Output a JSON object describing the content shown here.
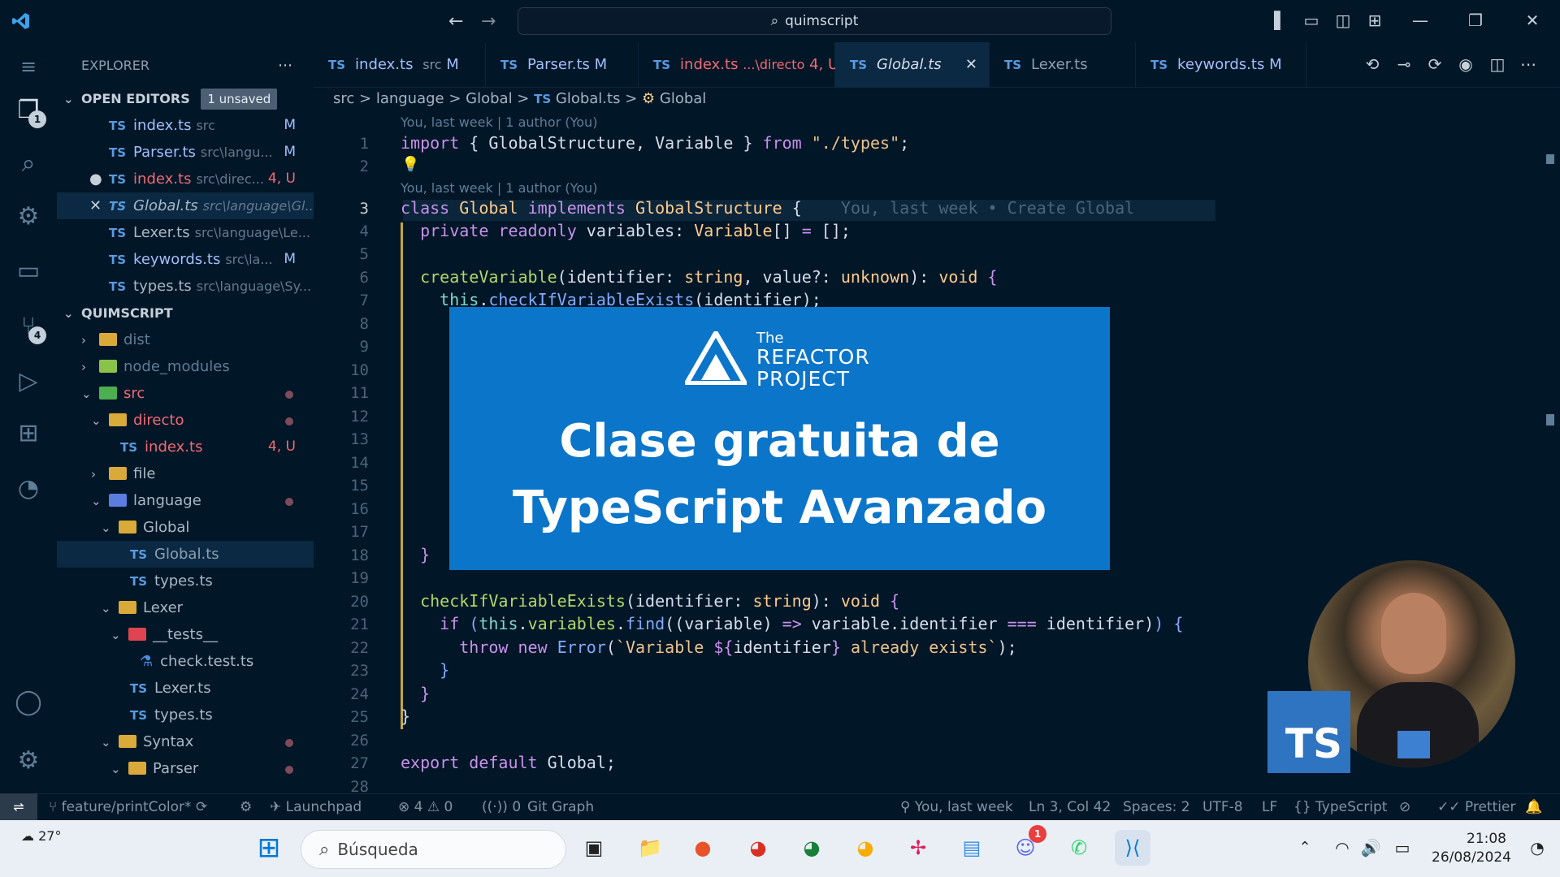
{
  "window": {
    "search_text": "quimscript"
  },
  "sidebar": {
    "title": "EXPLORER",
    "open_editors": {
      "label": "OPEN EDITORS",
      "unsaved_badge": "1 unsaved",
      "items": [
        {
          "name": "index.ts",
          "path": "src",
          "status": "M"
        },
        {
          "name": "Parser.ts",
          "path": "src\\langu...",
          "status": "M"
        },
        {
          "name": "index.ts",
          "path": "src\\direc...",
          "status": "4, U"
        },
        {
          "name": "Global.ts",
          "path": "src\\language\\Gl..."
        },
        {
          "name": "Lexer.ts",
          "path": "src\\language\\Le..."
        },
        {
          "name": "keywords.ts",
          "path": "src\\la...",
          "status": "M"
        },
        {
          "name": "types.ts",
          "path": "src\\language\\Sy..."
        }
      ]
    },
    "project": {
      "label": "QUIMSCRIPT",
      "tree": [
        {
          "name": "dist"
        },
        {
          "name": "node_modules"
        },
        {
          "name": "src"
        },
        {
          "name": "directo"
        },
        {
          "name": "index.ts",
          "status": "4, U"
        },
        {
          "name": "file"
        },
        {
          "name": "language"
        },
        {
          "name": "Global"
        },
        {
          "name": "Global.ts"
        },
        {
          "name": "types.ts"
        },
        {
          "name": "Lexer"
        },
        {
          "name": "__tests__"
        },
        {
          "name": "check.test.ts"
        },
        {
          "name": "Lexer.ts"
        },
        {
          "name": "types.ts"
        },
        {
          "name": "Syntax"
        },
        {
          "name": "Parser"
        }
      ]
    }
  },
  "tabs": [
    {
      "name": "index.ts",
      "path": "src",
      "status": "M"
    },
    {
      "name": "Parser.ts",
      "status": "M"
    },
    {
      "name": "index.ts",
      "path": "...\\directo",
      "status": "4, U"
    },
    {
      "name": "Global.ts"
    },
    {
      "name": "Lexer.ts"
    },
    {
      "name": "keywords.ts",
      "status": "M"
    }
  ],
  "breadcrumbs": {
    "a": "src",
    "b": "language",
    "c": "Global",
    "d": "Global.ts",
    "e": "Global"
  },
  "editor": {
    "codelens_1": "You, last week | 1 author (You)",
    "codelens_2": "You, last week | 1 author (You)",
    "blame_inline": "You, last week • Create Global",
    "line_numbers": [
      "1",
      "2",
      "3",
      "4",
      "5",
      "6",
      "7",
      "8",
      "9",
      "10",
      "11",
      "12",
      "13",
      "14",
      "15",
      "16",
      "17",
      "18",
      "19",
      "20",
      "21",
      "22",
      "23",
      "24",
      "25",
      "26",
      "27",
      "28"
    ]
  },
  "promo": {
    "brand_the": "The",
    "brand_line1": "REFACTOR",
    "brand_line2": "PROJECT",
    "headline_1": "Clase gratuita de",
    "headline_2": "TypeScript Avanzado"
  },
  "ts_logo": "TS",
  "statusbar": {
    "branch": "feature/printColor*",
    "launchpad": "Launchpad",
    "errors": "4",
    "warnings": "0",
    "ports": "0",
    "git_graph": "Git Graph",
    "blame": "You, last week",
    "position": "Ln 3, Col 42",
    "spaces": "Spaces: 2",
    "encoding": "UTF-8",
    "eol": "LF",
    "language": "TypeScript",
    "prettier": "Prettier"
  },
  "taskbar": {
    "weather": "27°",
    "search_placeholder": "Búsqueda",
    "time": "21:08",
    "date": "26/08/2024",
    "discord_badge": "1"
  },
  "colors": {
    "accent": "#0b75c9",
    "background": "#011627",
    "ts_blue": "#2f74c0"
  }
}
